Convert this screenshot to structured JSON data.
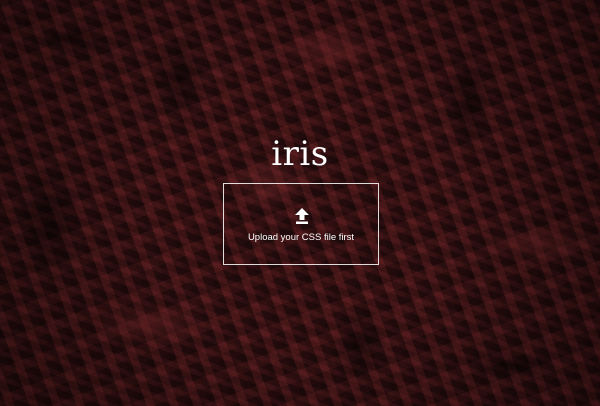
{
  "app": {
    "title": "iris"
  },
  "upload": {
    "label": "Upload your CSS file first",
    "icon": "upload-arrow-icon"
  },
  "colors": {
    "background": "#3a1214",
    "text": "#ffffff",
    "border": "#ffffff"
  }
}
